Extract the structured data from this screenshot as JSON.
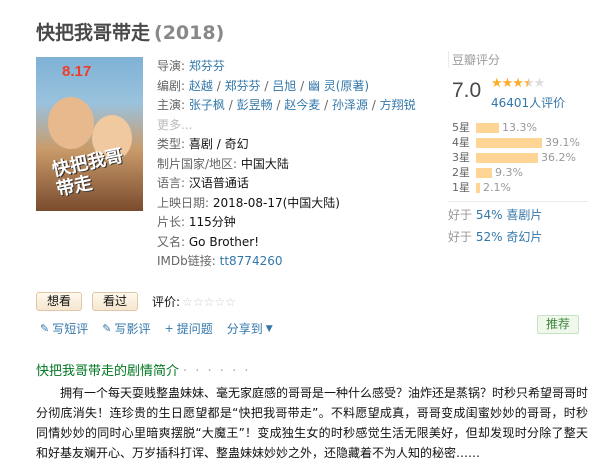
{
  "title": "快把我哥带走",
  "year": "(2018)",
  "poster": {
    "date_text": "8.17",
    "logo_text": "快把我哥带走"
  },
  "info": {
    "director_label": "导演:",
    "director": "郑芬芬",
    "writer_label": "编剧:",
    "writers": [
      "赵越",
      "郑芬芬",
      "吕旭",
      "幽 灵(原著)"
    ],
    "cast_label": "主演:",
    "cast": [
      "张子枫",
      "彭昱畅",
      "赵今麦",
      "孙泽源",
      "方翔锐"
    ],
    "cast_more": "更多...",
    "genre_label": "类型:",
    "genres": [
      "喜剧",
      "奇幻"
    ],
    "country_label": "制片国家/地区:",
    "country": "中国大陆",
    "language_label": "语言:",
    "language": "汉语普通话",
    "release_label": "上映日期:",
    "release": "2018-08-17(中国大陆)",
    "runtime_label": "片长:",
    "runtime": "115分钟",
    "aka_label": "又名:",
    "aka": "Go Brother!",
    "imdb_label": "IMDb链接:",
    "imdb": "tt8774260"
  },
  "rating": {
    "header": "豆瓣评分",
    "score": "7.0",
    "stars_filled": "★★★",
    "stars_half": "★",
    "stars_empty": "★",
    "votes": "46401人评价",
    "bars": [
      {
        "label": "5星",
        "pct_text": "13.3%",
        "pct": 13.3
      },
      {
        "label": "4星",
        "pct_text": "39.1%",
        "pct": 39.1
      },
      {
        "label": "3星",
        "pct_text": "36.2%",
        "pct": 36.2
      },
      {
        "label": "2星",
        "pct_text": "9.3%",
        "pct": 9.3
      },
      {
        "label": "1星",
        "pct_text": "2.1%",
        "pct": 2.1
      }
    ],
    "better1_prefix": "好于",
    "better1_pct": "54%",
    "better1_genre": "喜剧片",
    "better2_prefix": "好于",
    "better2_pct": "52%",
    "better2_genre": "奇幻片"
  },
  "actions": {
    "want": "想看",
    "seen": "看过",
    "rate_label": "评价:",
    "rate_stars": "☆☆☆☆☆"
  },
  "tools": {
    "write_short": "写短评",
    "write_review": "写影评",
    "ask": "提问题",
    "share": "分享到",
    "recommend": "推荐"
  },
  "summary": {
    "title": "快把我哥带走的剧情简介",
    "dots": "· · · · · ·",
    "text": "拥有一个每天耍贱整蛊妹妹、毫无家庭感的哥哥是一种什么感受？油炸还是蒸锅？时秒只希望哥哥时分彻底消失！连珍贵的生日愿望都是“快把我哥带走”。不料愿望成真，哥哥变成闺蜜妙妙的哥哥，时秒同情妙妙的同时心里暗爽摆脱“大魔王”！变成独生女的时秒感觉生活无限美好，但却发现时分除了整天和好基友斓开心、万岁插科打诨、整蛊妹妹妙妙之外，还隐藏着不为人知的秘密……"
  }
}
